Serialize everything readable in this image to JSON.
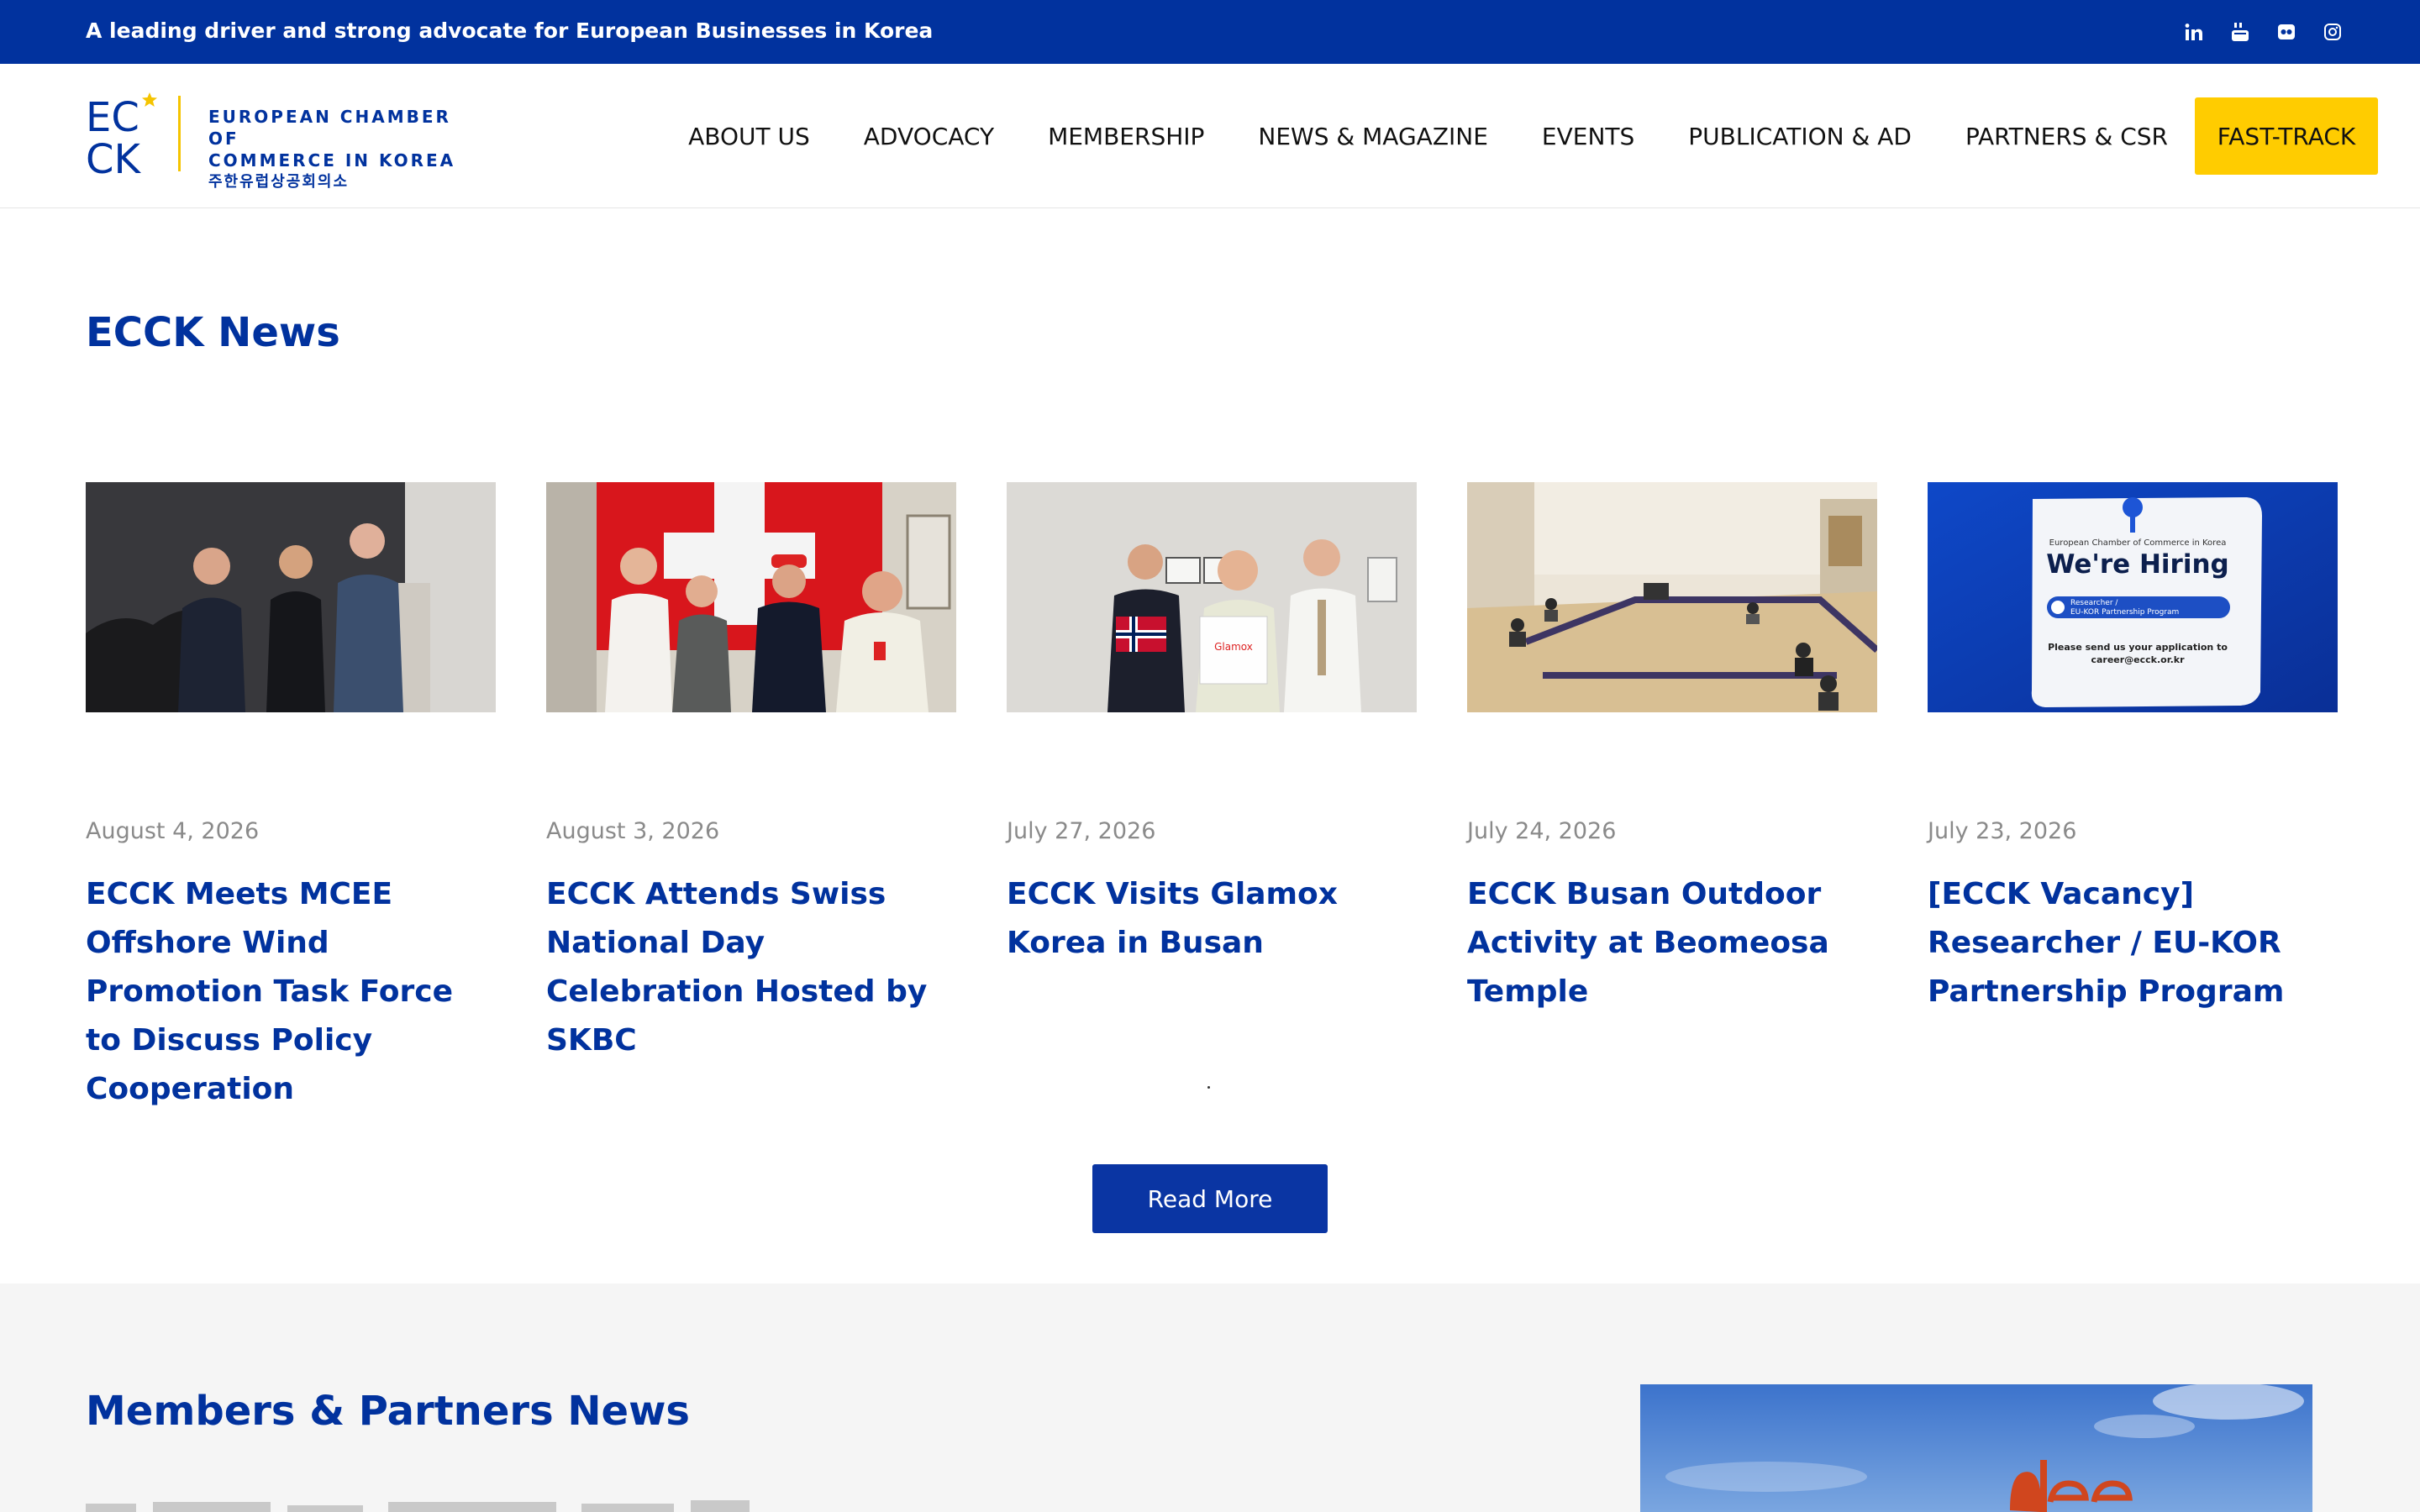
{
  "topbar": {
    "tagline": "A leading driver and strong advocate for European Businesses in Korea",
    "social_icons": [
      "linkedin-icon",
      "youtube-icon",
      "flickr-icon",
      "instagram-icon"
    ]
  },
  "logo": {
    "mark_top": "EC",
    "mark_bottom": "CK",
    "line1": "EUROPEAN CHAMBER OF",
    "line2": "COMMERCE IN KOREA",
    "line3": "주한유럽상공회의소"
  },
  "nav": {
    "items": [
      "ABOUT US",
      "ADVOCACY",
      "MEMBERSHIP",
      "NEWS & MAGAZINE",
      "EVENTS",
      "PUBLICATION & AD",
      "PARTNERS & CSR"
    ],
    "cta": "FAST-TRACK"
  },
  "ecck_news": {
    "title": "ECCK News",
    "cards": [
      {
        "date": "August 4, 2026",
        "headline": "ECCK Meets MCEE Offshore Wind Promotion Task Force to Discuss Policy Cooperation"
      },
      {
        "date": "August 3, 2026",
        "headline": "ECCK Attends Swiss National Day Celebration Hosted by SKBC"
      },
      {
        "date": "July 27, 2026",
        "headline": "ECCK Visits Glamox Korea in Busan"
      },
      {
        "date": "July 24, 2026",
        "headline": "ECCK Busan Outdoor Activity at Beomeosa Temple"
      },
      {
        "date": "July 23, 2026",
        "headline": "[ECCK Vacancy] Researcher / EU-KOR Partnership Program"
      }
    ],
    "hiring_image": {
      "org": "European Chamber of Commerce in Korea",
      "heading": "We're Hiring",
      "badge_line1": "Researcher /",
      "badge_line2": "EU-KOR Partnership Program",
      "note_line1": "Please send us your application to",
      "note_line2": "career@ecck.or.kr"
    },
    "glamox_label": "Glamox",
    "read_more": "Read More"
  },
  "members": {
    "title": "Members & Partners News"
  },
  "colors": {
    "brand_blue": "#01329e",
    "accent_yellow": "#ffcc00",
    "button_blue": "#0a35a3",
    "date_gray": "#8a8a8a"
  }
}
